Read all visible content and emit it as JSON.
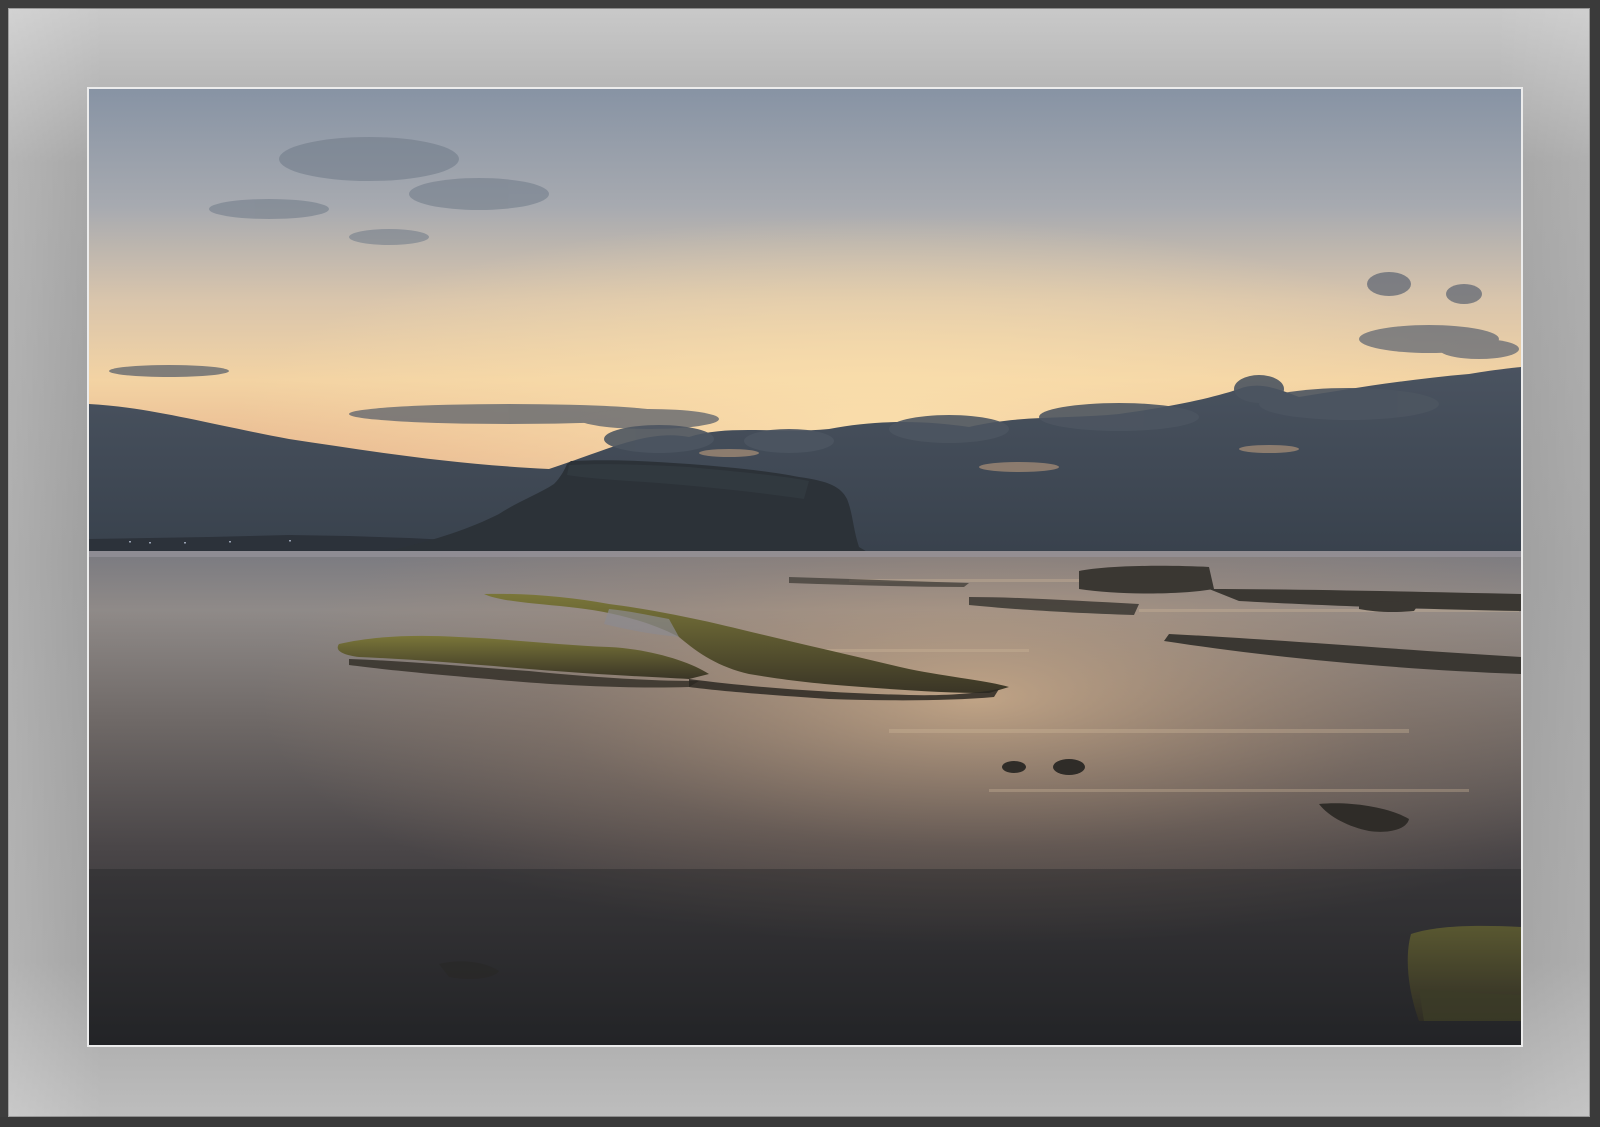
{
  "image": {
    "subject": "",
    "palette": {
      "sky_top": "#8c98a8",
      "sky_glow": "#f3cf9e",
      "cloud_dark": "#3a4350",
      "mountain": "#2d3339",
      "water_light": "#b8a38e",
      "water_dark": "#2b2c31",
      "moss": "#6b6a33",
      "mat": "#a0a0a0",
      "inner_border": "#ececec"
    },
    "icons": [
      "photo-image"
    ]
  }
}
